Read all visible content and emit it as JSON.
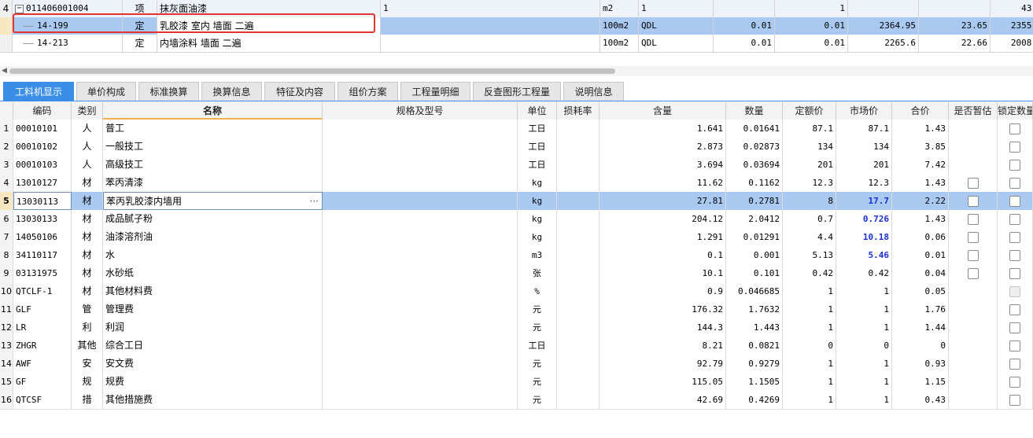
{
  "top_rows": [
    {
      "rownum": "4",
      "expand": "−",
      "code": "011406001004",
      "type": "项",
      "name": "抹灰面油漆",
      "spec": "1",
      "unit": "m2",
      "c1": "1",
      "c2": "",
      "c3": "1",
      "c4": "",
      "c5": "",
      "c6": "43."
    },
    {
      "rownum": "",
      "code": "14-199",
      "type": "定",
      "name": "乳胶漆 室内 墙面 二遍",
      "spec": "",
      "unit": "100m2",
      "c1": "QDL",
      "c2": "0.01",
      "c3": "0.01",
      "c4": "2364.95",
      "c5": "23.65",
      "c6": "2355."
    },
    {
      "rownum": "",
      "code": "14-213",
      "type": "定",
      "name": "内墙涂料 墙面 二遍",
      "spec": "",
      "unit": "100m2",
      "c1": "QDL",
      "c2": "0.01",
      "c3": "0.01",
      "c4": "2265.6",
      "c5": "22.66",
      "c6": "2008."
    }
  ],
  "scroll_arrow": "◀",
  "tabs": [
    "工料机显示",
    "单价构成",
    "标准换算",
    "换算信息",
    "特征及内容",
    "组价方案",
    "工程量明细",
    "反查图形工程量",
    "说明信息"
  ],
  "active_tab": 0,
  "columns": [
    "",
    "编码",
    "类别",
    "名称",
    "规格及型号",
    "单位",
    "损耗率",
    "含量",
    "数量",
    "定额价",
    "市场价",
    "合价",
    "是否暂估",
    "锁定数量"
  ],
  "rows": [
    {
      "n": "1",
      "code": "00010101",
      "cat": "人",
      "name": "普工",
      "spec": "",
      "unit": "工日",
      "loss": "",
      "qty": "1.641",
      "amount": "0.01641",
      "base": "87.1",
      "market": "87.1",
      "total": "1.43",
      "est": "none",
      "lock": "box",
      "blue": false
    },
    {
      "n": "2",
      "code": "00010102",
      "cat": "人",
      "name": "一般技工",
      "spec": "",
      "unit": "工日",
      "loss": "",
      "qty": "2.873",
      "amount": "0.02873",
      "base": "134",
      "market": "134",
      "total": "3.85",
      "est": "none",
      "lock": "box",
      "blue": false
    },
    {
      "n": "3",
      "code": "00010103",
      "cat": "人",
      "name": "高级技工",
      "spec": "",
      "unit": "工日",
      "loss": "",
      "qty": "3.694",
      "amount": "0.03694",
      "base": "201",
      "market": "201",
      "total": "7.42",
      "est": "none",
      "lock": "box",
      "blue": false
    },
    {
      "n": "4",
      "code": "13010127",
      "cat": "材",
      "name": "苯丙清漆",
      "spec": "",
      "unit": "kg",
      "loss": "",
      "qty": "11.62",
      "amount": "0.1162",
      "base": "12.3",
      "market": "12.3",
      "total": "1.43",
      "est": "box",
      "lock": "box",
      "blue": false
    },
    {
      "n": "5",
      "code": "13030113",
      "cat": "材",
      "name": "苯丙乳胶漆内墙用",
      "spec": "",
      "unit": "kg",
      "loss": "",
      "qty": "27.81",
      "amount": "0.2781",
      "base": "8",
      "market": "17.7",
      "total": "2.22",
      "est": "box",
      "lock": "box",
      "blue": true
    },
    {
      "n": "6",
      "code": "13030133",
      "cat": "材",
      "name": "成品腻子粉",
      "spec": "",
      "unit": "kg",
      "loss": "",
      "qty": "204.12",
      "amount": "2.0412",
      "base": "0.7",
      "market": "0.726",
      "total": "1.43",
      "est": "box",
      "lock": "box",
      "blue": true
    },
    {
      "n": "7",
      "code": "14050106",
      "cat": "材",
      "name": "油漆溶剂油",
      "spec": "",
      "unit": "kg",
      "loss": "",
      "qty": "1.291",
      "amount": "0.01291",
      "base": "4.4",
      "market": "10.18",
      "total": "0.06",
      "est": "box",
      "lock": "box",
      "blue": true
    },
    {
      "n": "8",
      "code": "34110117",
      "cat": "材",
      "name": "水",
      "spec": "",
      "unit": "m3",
      "loss": "",
      "qty": "0.1",
      "amount": "0.001",
      "base": "5.13",
      "market": "5.46",
      "total": "0.01",
      "est": "box",
      "lock": "box",
      "blue": true
    },
    {
      "n": "9",
      "code": "03131975",
      "cat": "材",
      "name": "水砂纸",
      "spec": "",
      "unit": "张",
      "loss": "",
      "qty": "10.1",
      "amount": "0.101",
      "base": "0.42",
      "market": "0.42",
      "total": "0.04",
      "est": "box",
      "lock": "box",
      "blue": false
    },
    {
      "n": "10",
      "code": "QTCLF-1",
      "cat": "材",
      "name": "其他材料费",
      "spec": "",
      "unit": "%",
      "loss": "",
      "qty": "0.9",
      "amount": "0.046685",
      "base": "1",
      "market": "1",
      "total": "0.05",
      "est": "none",
      "lock": "dis",
      "blue": false
    },
    {
      "n": "11",
      "code": "GLF",
      "cat": "管",
      "name": "管理费",
      "spec": "",
      "unit": "元",
      "loss": "",
      "qty": "176.32",
      "amount": "1.7632",
      "base": "1",
      "market": "1",
      "total": "1.76",
      "est": "none",
      "lock": "box",
      "blue": false
    },
    {
      "n": "12",
      "code": "LR",
      "cat": "利",
      "name": "利润",
      "spec": "",
      "unit": "元",
      "loss": "",
      "qty": "144.3",
      "amount": "1.443",
      "base": "1",
      "market": "1",
      "total": "1.44",
      "est": "none",
      "lock": "box",
      "blue": false
    },
    {
      "n": "13",
      "code": "ZHGR",
      "cat": "其他",
      "name": "综合工日",
      "spec": "",
      "unit": "工日",
      "loss": "",
      "qty": "8.21",
      "amount": "0.0821",
      "base": "0",
      "market": "0",
      "total": "0",
      "est": "none",
      "lock": "box",
      "blue": false
    },
    {
      "n": "14",
      "code": "AWF",
      "cat": "安",
      "name": "安文费",
      "spec": "",
      "unit": "元",
      "loss": "",
      "qty": "92.79",
      "amount": "0.9279",
      "base": "1",
      "market": "1",
      "total": "0.93",
      "est": "none",
      "lock": "box",
      "blue": false
    },
    {
      "n": "15",
      "code": "GF",
      "cat": "规",
      "name": "规费",
      "spec": "",
      "unit": "元",
      "loss": "",
      "qty": "115.05",
      "amount": "1.1505",
      "base": "1",
      "market": "1",
      "total": "1.15",
      "est": "none",
      "lock": "box",
      "blue": false
    },
    {
      "n": "16",
      "code": "QTCSF",
      "cat": "措",
      "name": "其他措施费",
      "spec": "",
      "unit": "元",
      "loss": "",
      "qty": "42.69",
      "amount": "0.4269",
      "base": "1",
      "market": "1",
      "total": "0.43",
      "est": "none",
      "lock": "box",
      "blue": false
    }
  ],
  "selected_row": 4,
  "ellipsis": "···"
}
